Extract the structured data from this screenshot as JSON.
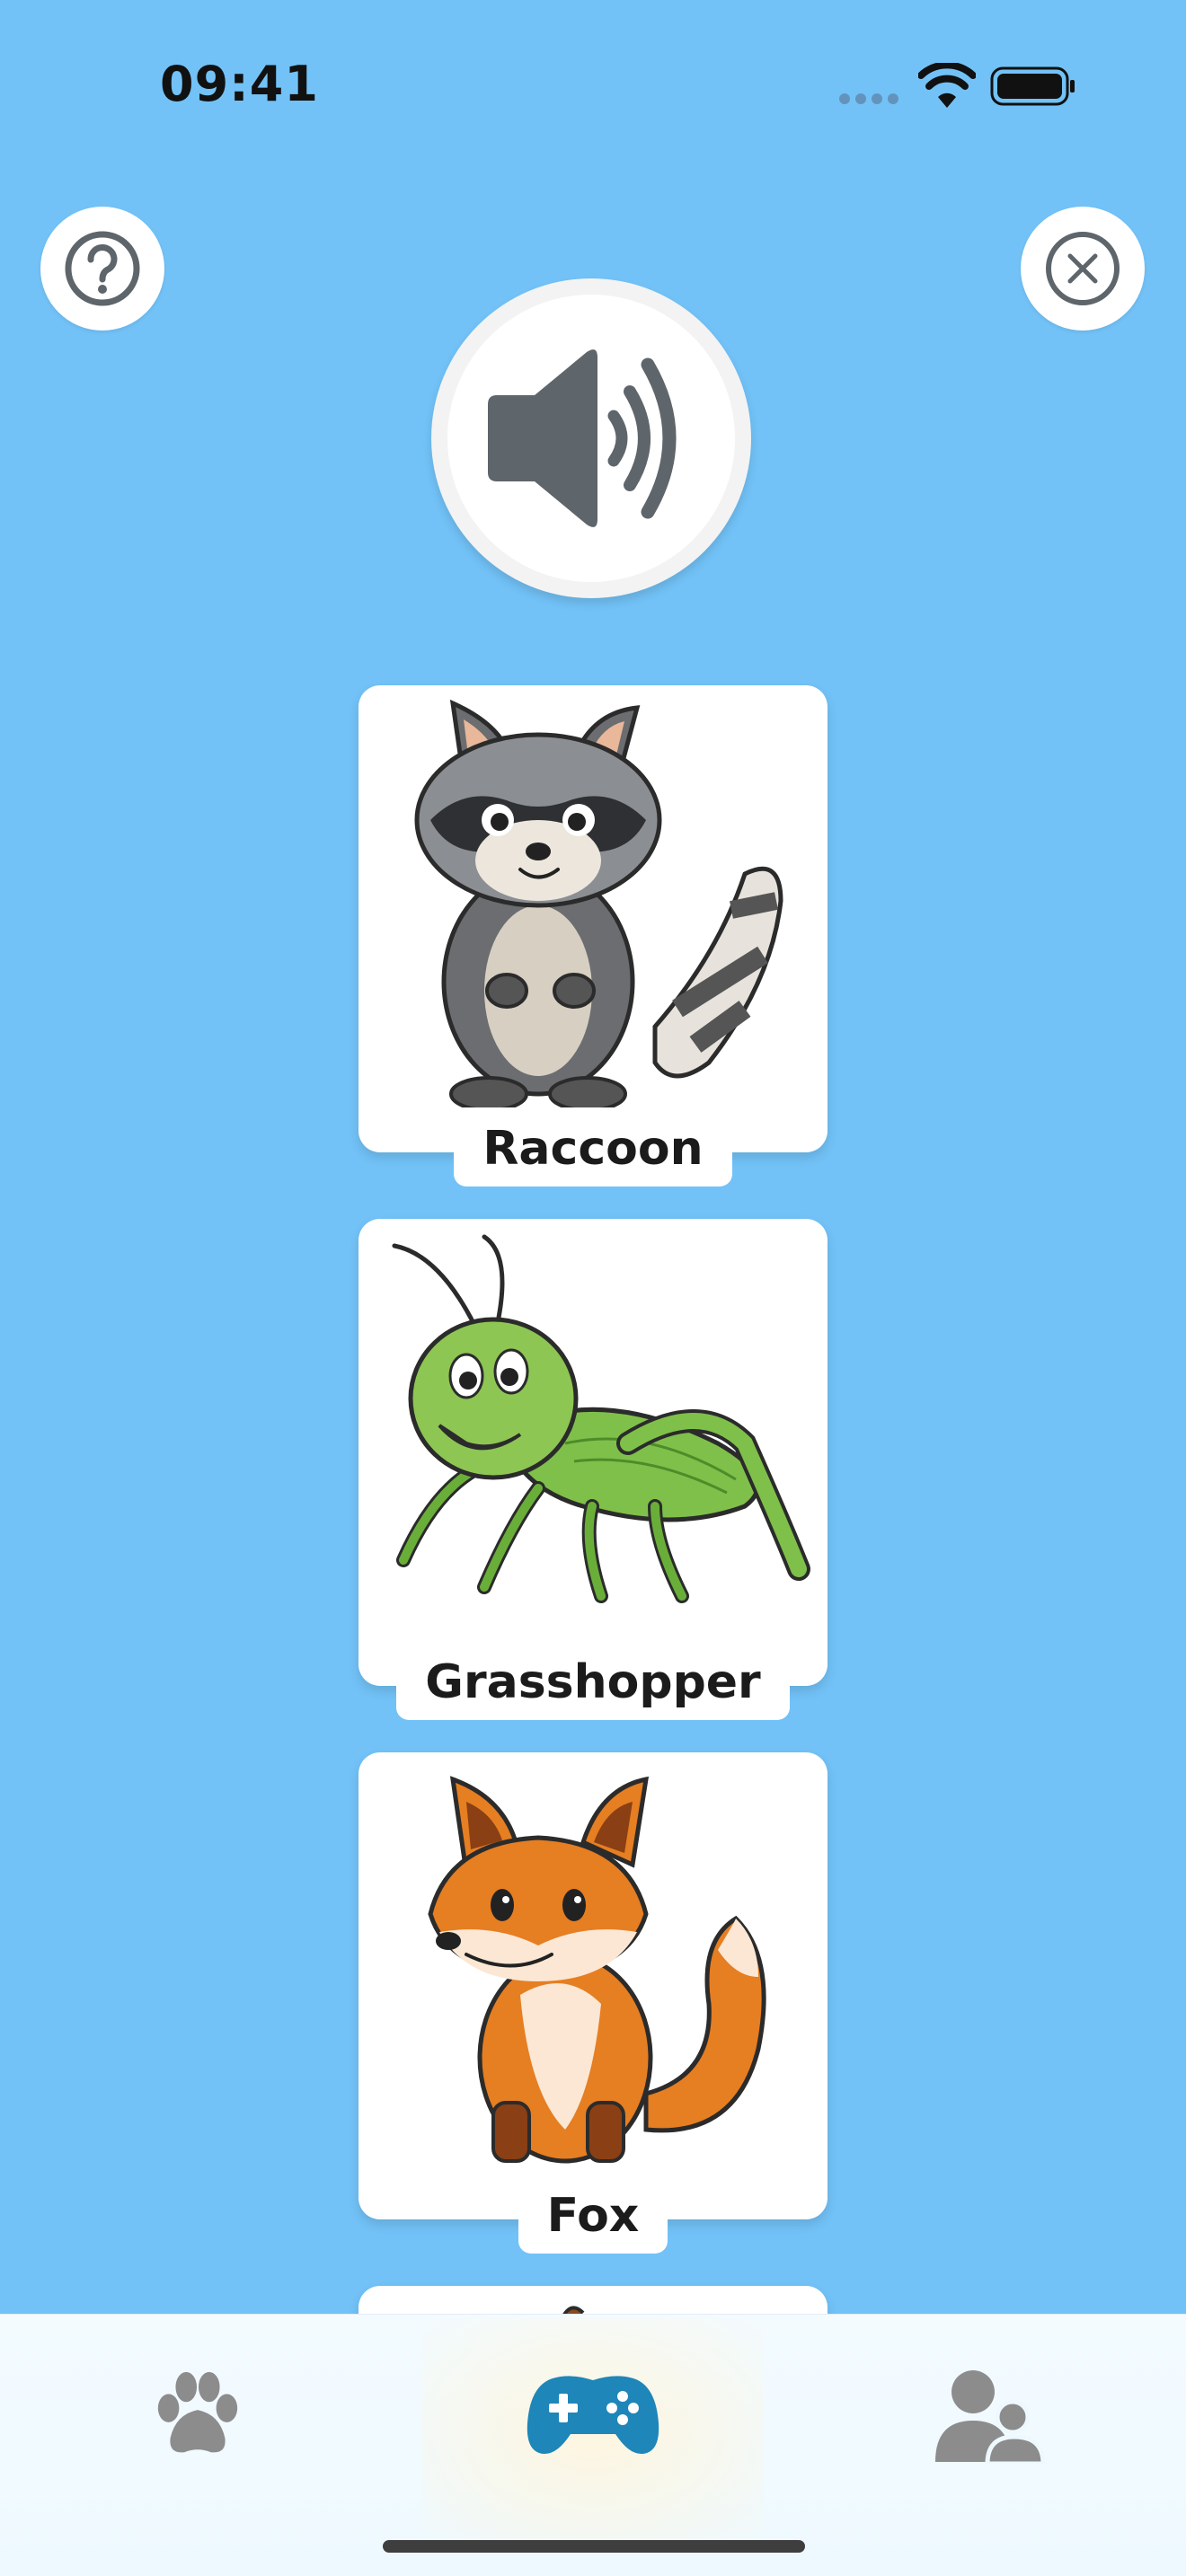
{
  "status_bar": {
    "time": "09:41"
  },
  "top_bar": {
    "help_icon": "question-circle-icon",
    "close_icon": "x-circle-icon"
  },
  "speaker": {
    "icon": "speaker-volume-icon"
  },
  "cards": [
    {
      "label": "Raccoon",
      "image": "raccoon-illustration"
    },
    {
      "label": "Grasshopper",
      "image": "grasshopper-illustration"
    },
    {
      "label": "Fox",
      "image": "fox-illustration"
    }
  ],
  "tab_bar": {
    "items": [
      {
        "name": "pets",
        "icon": "paw-icon",
        "selected": false
      },
      {
        "name": "games",
        "icon": "gamepad-icon",
        "selected": true
      },
      {
        "name": "profile",
        "icon": "users-icon",
        "selected": false
      }
    ]
  },
  "colors": {
    "background": "#72C2F7",
    "card": "#FFFFFF",
    "tab_active": "#1E86B8",
    "tab_inactive": "#8C8C8C",
    "icon_gray": "#5E656B"
  }
}
